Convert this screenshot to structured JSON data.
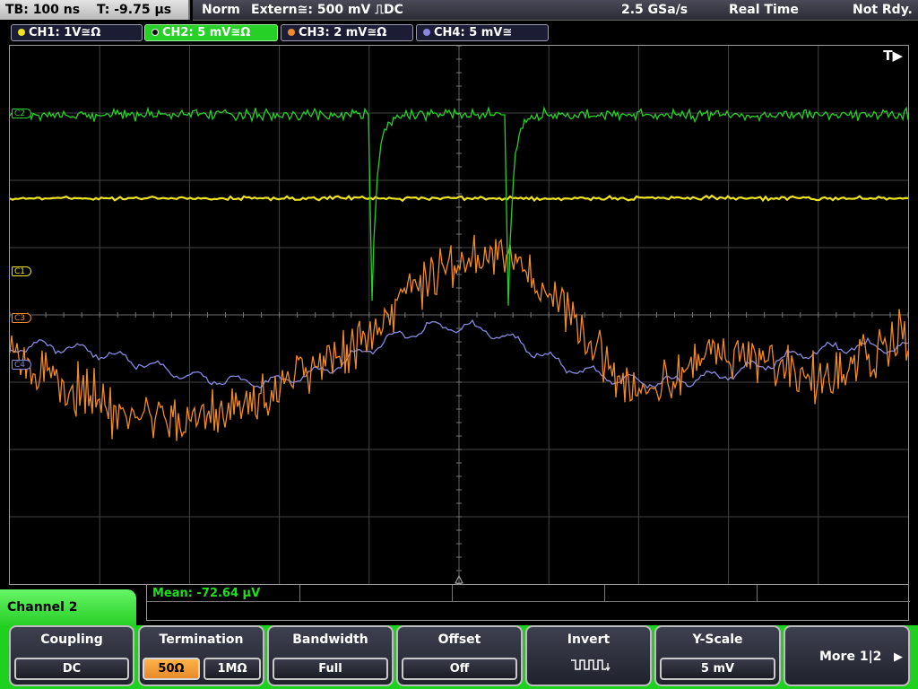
{
  "status": {
    "timebase": "TB: 100 ns",
    "trigger_time": "T: -9.75 µs",
    "mode": "Norm",
    "trigger": "Extern≅: 500 mV ⎍DC",
    "sample_rate": "2.5 GSa/s",
    "acq_mode": "Real Time",
    "state": "Not Rdy."
  },
  "channels": [
    {
      "label": "CH1: 1V≅Ω",
      "color": "#f0e41e",
      "active": false
    },
    {
      "label": "CH2: 5 mV≅Ω",
      "color": "#27d027",
      "active": true
    },
    {
      "label": "CH3: 2 mV≅Ω",
      "color": "#f08a2a",
      "active": false
    },
    {
      "label": "CH4: 5 mV≅",
      "color": "#8888e0",
      "active": false
    }
  ],
  "markers": {
    "trigger_flag": "T▶",
    "c1": "C1",
    "c2": "C2",
    "c3": "C3",
    "c4": "C4"
  },
  "measurement": {
    "text": "Mean: -72.64 µV",
    "color": "#1fe01f"
  },
  "menu": {
    "title": "Channel 2",
    "coupling": {
      "label": "Coupling",
      "value": "DC"
    },
    "termination": {
      "label": "Termination",
      "opt1": "50Ω",
      "opt2": "1MΩ",
      "selected": "50Ω"
    },
    "bandwidth": {
      "label": "Bandwidth",
      "value": "Full"
    },
    "offset": {
      "label": "Offset",
      "value": "Off"
    },
    "invert": {
      "label": "Invert",
      "icon": "inverted-pulse-icon"
    },
    "yscale": {
      "label": "Y-Scale",
      "value": "5 mV"
    },
    "more": {
      "label": "More 1|2",
      "icon": "right-arrow-icon"
    }
  }
}
